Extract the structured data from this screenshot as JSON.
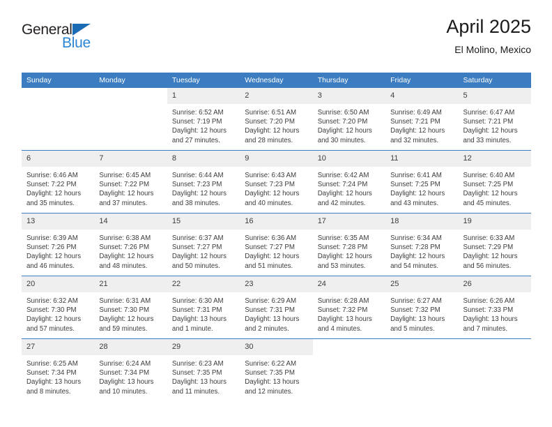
{
  "brand": {
    "name_dark": "General",
    "name_blue": "Blue",
    "accent_blue": "#2b84d4",
    "logo_triangle_color": "#1b6cb5"
  },
  "header": {
    "title": "April 2025",
    "subtitle": "El Molino, Mexico",
    "header_bg": "#3b7dc0",
    "daynum_bg": "#efefef"
  },
  "weekdays": [
    "Sunday",
    "Monday",
    "Tuesday",
    "Wednesday",
    "Thursday",
    "Friday",
    "Saturday"
  ],
  "labels": {
    "sunrise": "Sunrise:",
    "sunset": "Sunset:",
    "daylight": "Daylight:"
  },
  "weeks": [
    [
      {
        "day": "",
        "blank": true
      },
      {
        "day": "",
        "blank": true
      },
      {
        "day": "1",
        "sunrise": "Sunrise: 6:52 AM",
        "sunset": "Sunset: 7:19 PM",
        "daylight_1": "Daylight: 12 hours",
        "daylight_2": "and 27 minutes."
      },
      {
        "day": "2",
        "sunrise": "Sunrise: 6:51 AM",
        "sunset": "Sunset: 7:20 PM",
        "daylight_1": "Daylight: 12 hours",
        "daylight_2": "and 28 minutes."
      },
      {
        "day": "3",
        "sunrise": "Sunrise: 6:50 AM",
        "sunset": "Sunset: 7:20 PM",
        "daylight_1": "Daylight: 12 hours",
        "daylight_2": "and 30 minutes."
      },
      {
        "day": "4",
        "sunrise": "Sunrise: 6:49 AM",
        "sunset": "Sunset: 7:21 PM",
        "daylight_1": "Daylight: 12 hours",
        "daylight_2": "and 32 minutes."
      },
      {
        "day": "5",
        "sunrise": "Sunrise: 6:47 AM",
        "sunset": "Sunset: 7:21 PM",
        "daylight_1": "Daylight: 12 hours",
        "daylight_2": "and 33 minutes."
      }
    ],
    [
      {
        "day": "6",
        "sunrise": "Sunrise: 6:46 AM",
        "sunset": "Sunset: 7:22 PM",
        "daylight_1": "Daylight: 12 hours",
        "daylight_2": "and 35 minutes."
      },
      {
        "day": "7",
        "sunrise": "Sunrise: 6:45 AM",
        "sunset": "Sunset: 7:22 PM",
        "daylight_1": "Daylight: 12 hours",
        "daylight_2": "and 37 minutes."
      },
      {
        "day": "8",
        "sunrise": "Sunrise: 6:44 AM",
        "sunset": "Sunset: 7:23 PM",
        "daylight_1": "Daylight: 12 hours",
        "daylight_2": "and 38 minutes."
      },
      {
        "day": "9",
        "sunrise": "Sunrise: 6:43 AM",
        "sunset": "Sunset: 7:23 PM",
        "daylight_1": "Daylight: 12 hours",
        "daylight_2": "and 40 minutes."
      },
      {
        "day": "10",
        "sunrise": "Sunrise: 6:42 AM",
        "sunset": "Sunset: 7:24 PM",
        "daylight_1": "Daylight: 12 hours",
        "daylight_2": "and 42 minutes."
      },
      {
        "day": "11",
        "sunrise": "Sunrise: 6:41 AM",
        "sunset": "Sunset: 7:25 PM",
        "daylight_1": "Daylight: 12 hours",
        "daylight_2": "and 43 minutes."
      },
      {
        "day": "12",
        "sunrise": "Sunrise: 6:40 AM",
        "sunset": "Sunset: 7:25 PM",
        "daylight_1": "Daylight: 12 hours",
        "daylight_2": "and 45 minutes."
      }
    ],
    [
      {
        "day": "13",
        "sunrise": "Sunrise: 6:39 AM",
        "sunset": "Sunset: 7:26 PM",
        "daylight_1": "Daylight: 12 hours",
        "daylight_2": "and 46 minutes."
      },
      {
        "day": "14",
        "sunrise": "Sunrise: 6:38 AM",
        "sunset": "Sunset: 7:26 PM",
        "daylight_1": "Daylight: 12 hours",
        "daylight_2": "and 48 minutes."
      },
      {
        "day": "15",
        "sunrise": "Sunrise: 6:37 AM",
        "sunset": "Sunset: 7:27 PM",
        "daylight_1": "Daylight: 12 hours",
        "daylight_2": "and 50 minutes."
      },
      {
        "day": "16",
        "sunrise": "Sunrise: 6:36 AM",
        "sunset": "Sunset: 7:27 PM",
        "daylight_1": "Daylight: 12 hours",
        "daylight_2": "and 51 minutes."
      },
      {
        "day": "17",
        "sunrise": "Sunrise: 6:35 AM",
        "sunset": "Sunset: 7:28 PM",
        "daylight_1": "Daylight: 12 hours",
        "daylight_2": "and 53 minutes."
      },
      {
        "day": "18",
        "sunrise": "Sunrise: 6:34 AM",
        "sunset": "Sunset: 7:28 PM",
        "daylight_1": "Daylight: 12 hours",
        "daylight_2": "and 54 minutes."
      },
      {
        "day": "19",
        "sunrise": "Sunrise: 6:33 AM",
        "sunset": "Sunset: 7:29 PM",
        "daylight_1": "Daylight: 12 hours",
        "daylight_2": "and 56 minutes."
      }
    ],
    [
      {
        "day": "20",
        "sunrise": "Sunrise: 6:32 AM",
        "sunset": "Sunset: 7:30 PM",
        "daylight_1": "Daylight: 12 hours",
        "daylight_2": "and 57 minutes."
      },
      {
        "day": "21",
        "sunrise": "Sunrise: 6:31 AM",
        "sunset": "Sunset: 7:30 PM",
        "daylight_1": "Daylight: 12 hours",
        "daylight_2": "and 59 minutes."
      },
      {
        "day": "22",
        "sunrise": "Sunrise: 6:30 AM",
        "sunset": "Sunset: 7:31 PM",
        "daylight_1": "Daylight: 13 hours",
        "daylight_2": "and 1 minute."
      },
      {
        "day": "23",
        "sunrise": "Sunrise: 6:29 AM",
        "sunset": "Sunset: 7:31 PM",
        "daylight_1": "Daylight: 13 hours",
        "daylight_2": "and 2 minutes."
      },
      {
        "day": "24",
        "sunrise": "Sunrise: 6:28 AM",
        "sunset": "Sunset: 7:32 PM",
        "daylight_1": "Daylight: 13 hours",
        "daylight_2": "and 4 minutes."
      },
      {
        "day": "25",
        "sunrise": "Sunrise: 6:27 AM",
        "sunset": "Sunset: 7:32 PM",
        "daylight_1": "Daylight: 13 hours",
        "daylight_2": "and 5 minutes."
      },
      {
        "day": "26",
        "sunrise": "Sunrise: 6:26 AM",
        "sunset": "Sunset: 7:33 PM",
        "daylight_1": "Daylight: 13 hours",
        "daylight_2": "and 7 minutes."
      }
    ],
    [
      {
        "day": "27",
        "sunrise": "Sunrise: 6:25 AM",
        "sunset": "Sunset: 7:34 PM",
        "daylight_1": "Daylight: 13 hours",
        "daylight_2": "and 8 minutes."
      },
      {
        "day": "28",
        "sunrise": "Sunrise: 6:24 AM",
        "sunset": "Sunset: 7:34 PM",
        "daylight_1": "Daylight: 13 hours",
        "daylight_2": "and 10 minutes."
      },
      {
        "day": "29",
        "sunrise": "Sunrise: 6:23 AM",
        "sunset": "Sunset: 7:35 PM",
        "daylight_1": "Daylight: 13 hours",
        "daylight_2": "and 11 minutes."
      },
      {
        "day": "30",
        "sunrise": "Sunrise: 6:22 AM",
        "sunset": "Sunset: 7:35 PM",
        "daylight_1": "Daylight: 13 hours",
        "daylight_2": "and 12 minutes."
      },
      {
        "day": "",
        "blank": true
      },
      {
        "day": "",
        "blank": true
      },
      {
        "day": "",
        "blank": true
      }
    ]
  ]
}
